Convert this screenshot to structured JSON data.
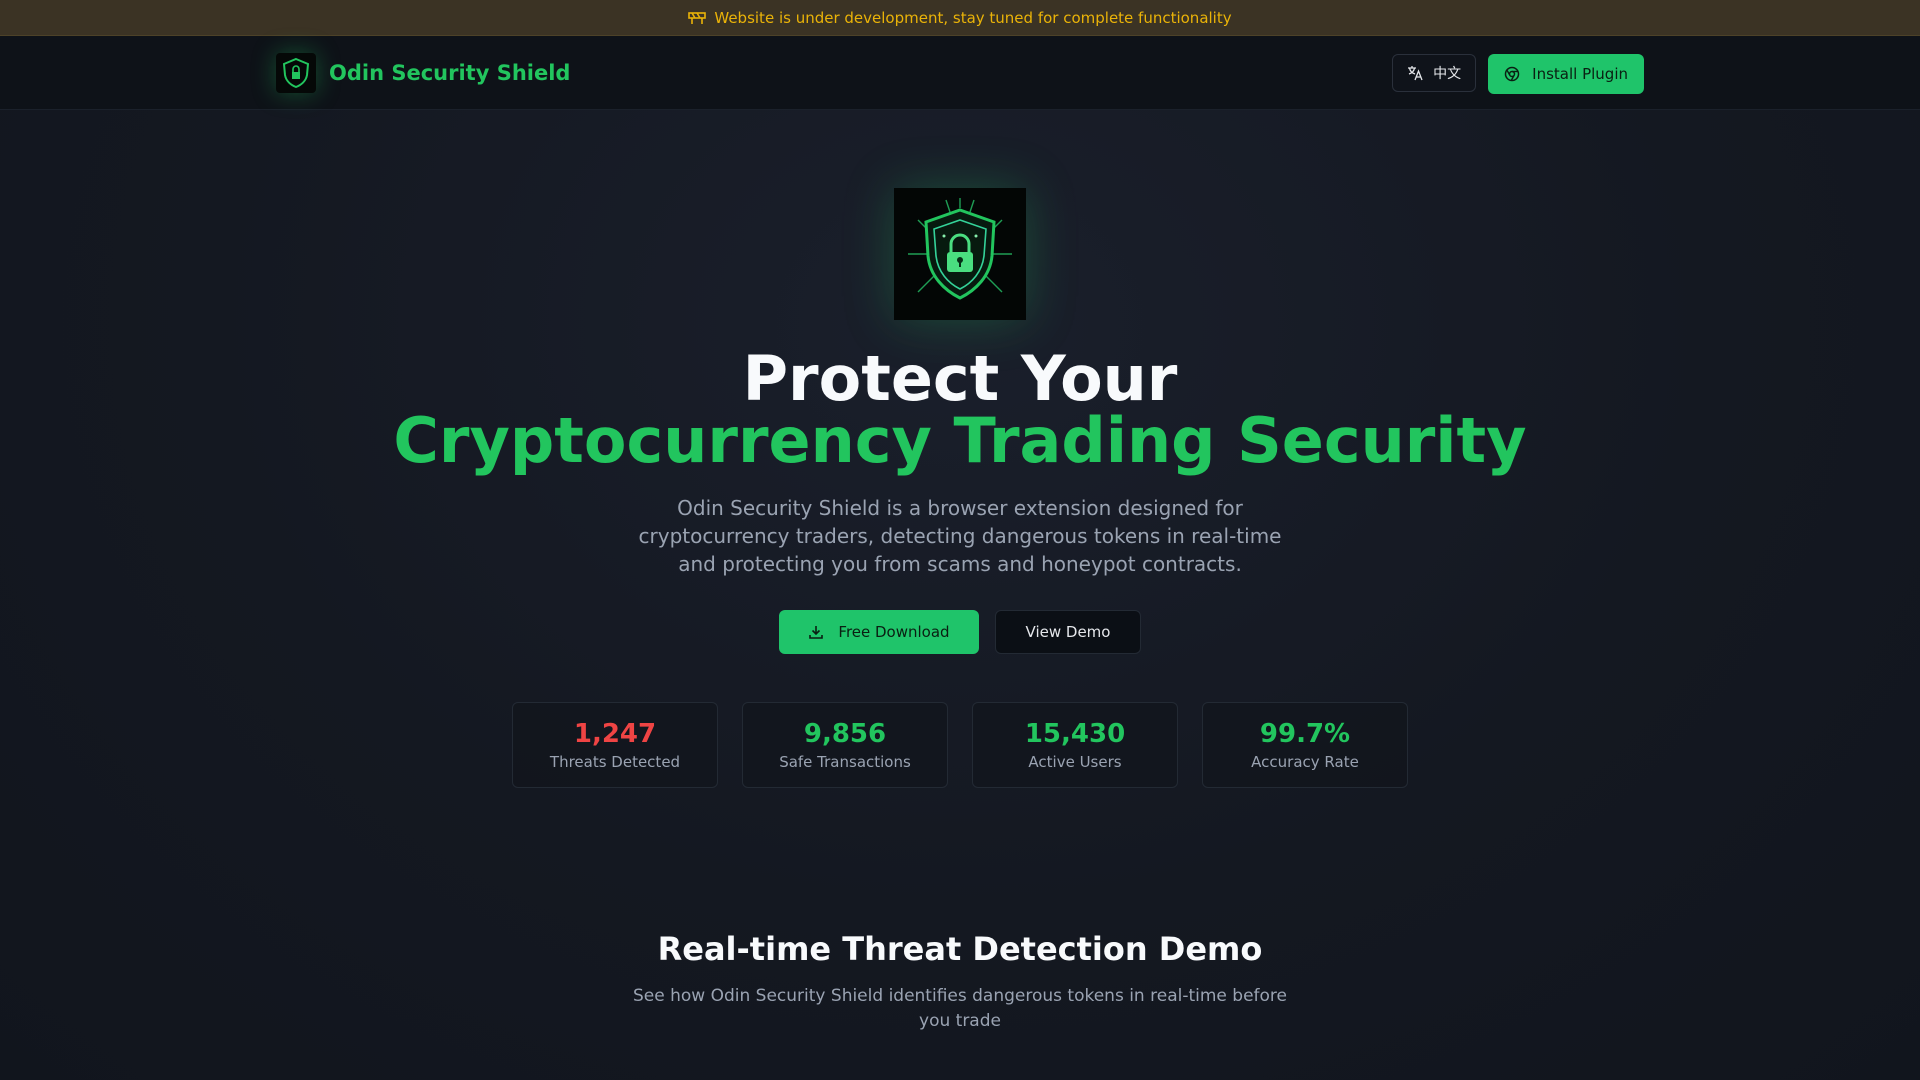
{
  "banner": {
    "icon": "construction-icon",
    "text": "Website is under development, stay tuned for complete functionality"
  },
  "header": {
    "brand_name": "Odin Security Shield",
    "lang_label": "中文",
    "install_label": "Install Plugin"
  },
  "hero": {
    "title_line1": "Protect Your",
    "title_line2": "Cryptocurrency Trading Security",
    "description": "Odin Security Shield is a browser extension designed for cryptocurrency traders, detecting dangerous tokens in real-time and protecting you from scams and honeypot contracts.",
    "primary_cta": "Free Download",
    "secondary_cta": "View Demo"
  },
  "stats": [
    {
      "value": "1,247",
      "label": "Threats Detected",
      "color": "#ef4444"
    },
    {
      "value": "9,856",
      "label": "Safe Transactions",
      "color": "#22c55e"
    },
    {
      "value": "15,430",
      "label": "Active Users",
      "color": "#22c55e"
    },
    {
      "value": "99.7%",
      "label": "Accuracy Rate",
      "color": "#22c55e"
    }
  ],
  "demo": {
    "title": "Real-time Threat Detection Demo",
    "description": "See how Odin Security Shield identifies dangerous tokens in real-time before you trade"
  },
  "colors": {
    "accent": "#22c55e",
    "danger": "#ef4444",
    "warning": "#eab308"
  }
}
